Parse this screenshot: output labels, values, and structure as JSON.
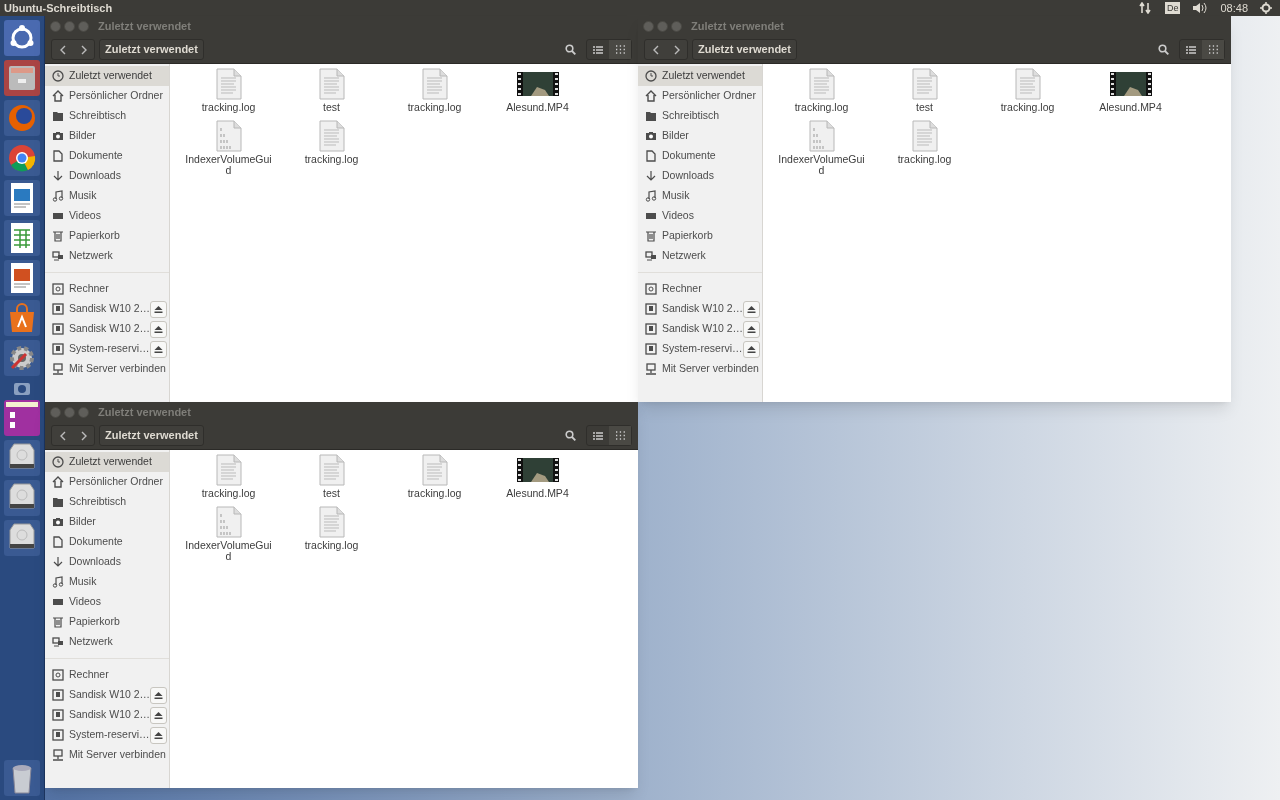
{
  "top_bar": {
    "title": "Ubuntu-Schreibtisch",
    "keyboard_layout": "De",
    "clock": "08:48"
  },
  "windows": [
    {
      "title": "Zuletzt verwendet",
      "path_button": "Zuletzt verwendet",
      "places": [
        {
          "label": "Zuletzt verwendet",
          "kind": "recent",
          "selected": true
        },
        {
          "label": "Persönlicher Ordner",
          "kind": "home",
          "selected": false
        },
        {
          "label": "Schreibtisch",
          "kind": "folder",
          "selected": false
        },
        {
          "label": "Bilder",
          "kind": "camera",
          "selected": false
        },
        {
          "label": "Dokumente",
          "kind": "document",
          "selected": false
        },
        {
          "label": "Downloads",
          "kind": "download",
          "selected": false
        },
        {
          "label": "Musik",
          "kind": "music",
          "selected": false
        },
        {
          "label": "Videos",
          "kind": "video",
          "selected": false
        },
        {
          "label": "Papierkorb",
          "kind": "trash",
          "selected": false
        },
        {
          "label": "Netzwerk",
          "kind": "network",
          "selected": false
        }
      ],
      "devices": [
        {
          "label": "Rechner",
          "kind": "computer",
          "ejectable": false,
          "selected": false
        },
        {
          "label": "Sandisk W10 2…",
          "kind": "drive",
          "ejectable": true,
          "selected": false
        },
        {
          "label": "Sandisk W10 2…",
          "kind": "drive",
          "ejectable": true,
          "selected": false
        },
        {
          "label": "System-reservi…",
          "kind": "drive",
          "ejectable": true,
          "selected": false
        },
        {
          "label": "Mit Server verbinden",
          "kind": "server",
          "ejectable": false,
          "selected": false
        }
      ],
      "files": [
        {
          "name": "tracking.log",
          "kind": "text"
        },
        {
          "name": "test",
          "kind": "text"
        },
        {
          "name": "tracking.log",
          "kind": "text"
        },
        {
          "name": "Alesund.MP4",
          "kind": "video"
        },
        {
          "name": "IndexerVolumeGuid",
          "kind": "binary"
        },
        {
          "name": "tracking.log",
          "kind": "text"
        }
      ]
    },
    {
      "title": "Zuletzt verwendet",
      "path_button": "Zuletzt verwendet",
      "places": [
        {
          "label": "Zuletzt verwendet",
          "kind": "recent",
          "selected": true
        },
        {
          "label": "Persönlicher Ordner",
          "kind": "home",
          "selected": false
        },
        {
          "label": "Schreibtisch",
          "kind": "folder",
          "selected": false
        },
        {
          "label": "Bilder",
          "kind": "camera",
          "selected": false
        },
        {
          "label": "Dokumente",
          "kind": "document",
          "selected": false
        },
        {
          "label": "Downloads",
          "kind": "download",
          "selected": false
        },
        {
          "label": "Musik",
          "kind": "music",
          "selected": false
        },
        {
          "label": "Videos",
          "kind": "video",
          "selected": false
        },
        {
          "label": "Papierkorb",
          "kind": "trash",
          "selected": false
        },
        {
          "label": "Netzwerk",
          "kind": "network",
          "selected": false
        }
      ],
      "devices": [
        {
          "label": "Rechner",
          "kind": "computer",
          "ejectable": false,
          "selected": false
        },
        {
          "label": "Sandisk W10 2…",
          "kind": "drive",
          "ejectable": true,
          "selected": false
        },
        {
          "label": "Sandisk W10 2…",
          "kind": "drive",
          "ejectable": true,
          "selected": false
        },
        {
          "label": "System-reservi…",
          "kind": "drive",
          "ejectable": true,
          "selected": false
        },
        {
          "label": "Mit Server verbinden",
          "kind": "server",
          "ejectable": false,
          "selected": false
        }
      ],
      "files": [
        {
          "name": "tracking.log",
          "kind": "text"
        },
        {
          "name": "test",
          "kind": "text"
        },
        {
          "name": "tracking.log",
          "kind": "text"
        },
        {
          "name": "Alesund.MP4",
          "kind": "video"
        },
        {
          "name": "IndexerVolumeGuid",
          "kind": "binary"
        },
        {
          "name": "tracking.log",
          "kind": "text"
        }
      ]
    },
    {
      "title": "Zuletzt verwendet",
      "path_button": "Zuletzt verwendet",
      "places": [
        {
          "label": "Zuletzt verwendet",
          "kind": "recent",
          "selected": true
        },
        {
          "label": "Persönlicher Ordner",
          "kind": "home",
          "selected": false
        },
        {
          "label": "Schreibtisch",
          "kind": "folder",
          "selected": false
        },
        {
          "label": "Bilder",
          "kind": "camera",
          "selected": false
        },
        {
          "label": "Dokumente",
          "kind": "document",
          "selected": false
        },
        {
          "label": "Downloads",
          "kind": "download",
          "selected": false
        },
        {
          "label": "Musik",
          "kind": "music",
          "selected": false
        },
        {
          "label": "Videos",
          "kind": "video",
          "selected": false
        },
        {
          "label": "Papierkorb",
          "kind": "trash",
          "selected": false
        },
        {
          "label": "Netzwerk",
          "kind": "network",
          "selected": false
        }
      ],
      "devices": [
        {
          "label": "Rechner",
          "kind": "computer",
          "ejectable": false,
          "selected": false
        },
        {
          "label": "Sandisk W10 2…",
          "kind": "drive",
          "ejectable": true,
          "selected": false
        },
        {
          "label": "Sandisk W10 2…",
          "kind": "drive",
          "ejectable": true,
          "selected": false
        },
        {
          "label": "System-reservi…",
          "kind": "drive",
          "ejectable": true,
          "selected": false
        },
        {
          "label": "Mit Server verbinden",
          "kind": "server",
          "ejectable": false,
          "selected": false
        }
      ],
      "files": [
        {
          "name": "tracking.log",
          "kind": "text"
        },
        {
          "name": "test",
          "kind": "text"
        },
        {
          "name": "tracking.log",
          "kind": "text"
        },
        {
          "name": "Alesund.MP4",
          "kind": "video"
        },
        {
          "name": "IndexerVolumeGuid",
          "kind": "binary"
        },
        {
          "name": "tracking.log",
          "kind": "text"
        }
      ]
    }
  ]
}
